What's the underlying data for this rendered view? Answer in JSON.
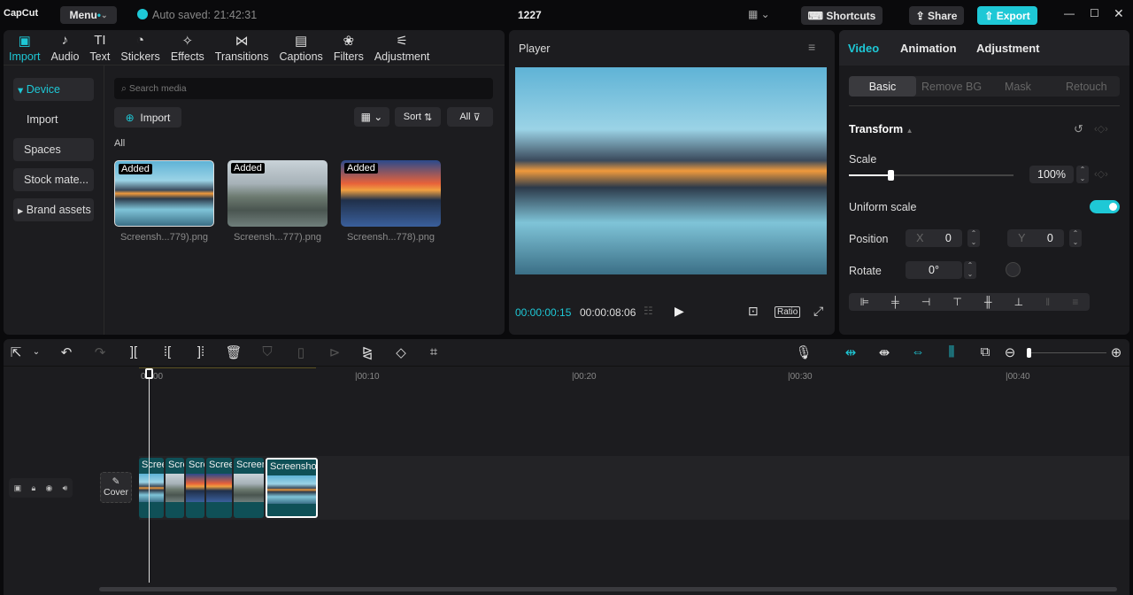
{
  "app": {
    "logo": "CapCut",
    "menu": "Menu",
    "autosave": "Auto saved: 21:42:31",
    "title": "1227",
    "shortcuts": "Shortcuts",
    "share": "Share",
    "export": "Export"
  },
  "media_tabs": [
    {
      "label": "Import",
      "icon": "import-icon"
    },
    {
      "label": "Audio",
      "icon": "audio-icon"
    },
    {
      "label": "Text",
      "icon": "text-icon"
    },
    {
      "label": "Stickers",
      "icon": "stickers-icon"
    },
    {
      "label": "Effects",
      "icon": "effects-icon"
    },
    {
      "label": "Transitions",
      "icon": "transitions-icon"
    },
    {
      "label": "Captions",
      "icon": "captions-icon"
    },
    {
      "label": "Filters",
      "icon": "filters-icon"
    },
    {
      "label": "Adjustment",
      "icon": "adjustment-icon"
    }
  ],
  "sidebar": {
    "device": "Device",
    "import": "Import",
    "spaces": "Spaces",
    "stock": "Stock mate...",
    "brand": "Brand assets"
  },
  "media": {
    "search_placeholder": "Search media",
    "import": "Import",
    "sort": "Sort",
    "all_filter": "All",
    "section": "All",
    "items": [
      {
        "badge": "Added",
        "name": "Screensh...779).png"
      },
      {
        "badge": "Added",
        "name": "Screensh...777).png"
      },
      {
        "badge": "Added",
        "name": "Screensh...778).png"
      }
    ]
  },
  "player": {
    "title": "Player",
    "current": "00:00:00:15",
    "total": "00:00:08:06",
    "ratio": "Ratio"
  },
  "right": {
    "tabs": [
      "Video",
      "Animation",
      "Adjustment"
    ],
    "subtabs": [
      "Basic",
      "Remove BG",
      "Mask",
      "Retouch"
    ],
    "section": "Transform",
    "scale_label": "Scale",
    "scale_value": "100%",
    "scale_fraction": 0.25,
    "uniform": "Uniform scale",
    "uniform_on": true,
    "position": "Position",
    "x_label": "X",
    "x": "0",
    "y_label": "Y",
    "y": "0",
    "rotate": "Rotate",
    "rotate_value": "0°"
  },
  "timeline": {
    "ticks": [
      "00:00",
      "|00:10",
      "|00:20",
      "|00:30",
      "|00:40"
    ],
    "cover": "Cover",
    "clips": [
      "Screenshot",
      "Screenshot",
      "Screenshot",
      "Screenshot",
      "Screenshot",
      "Screenshot"
    ]
  },
  "colors": {
    "accent": "#1ec8d6",
    "clip": "#0f5057"
  }
}
